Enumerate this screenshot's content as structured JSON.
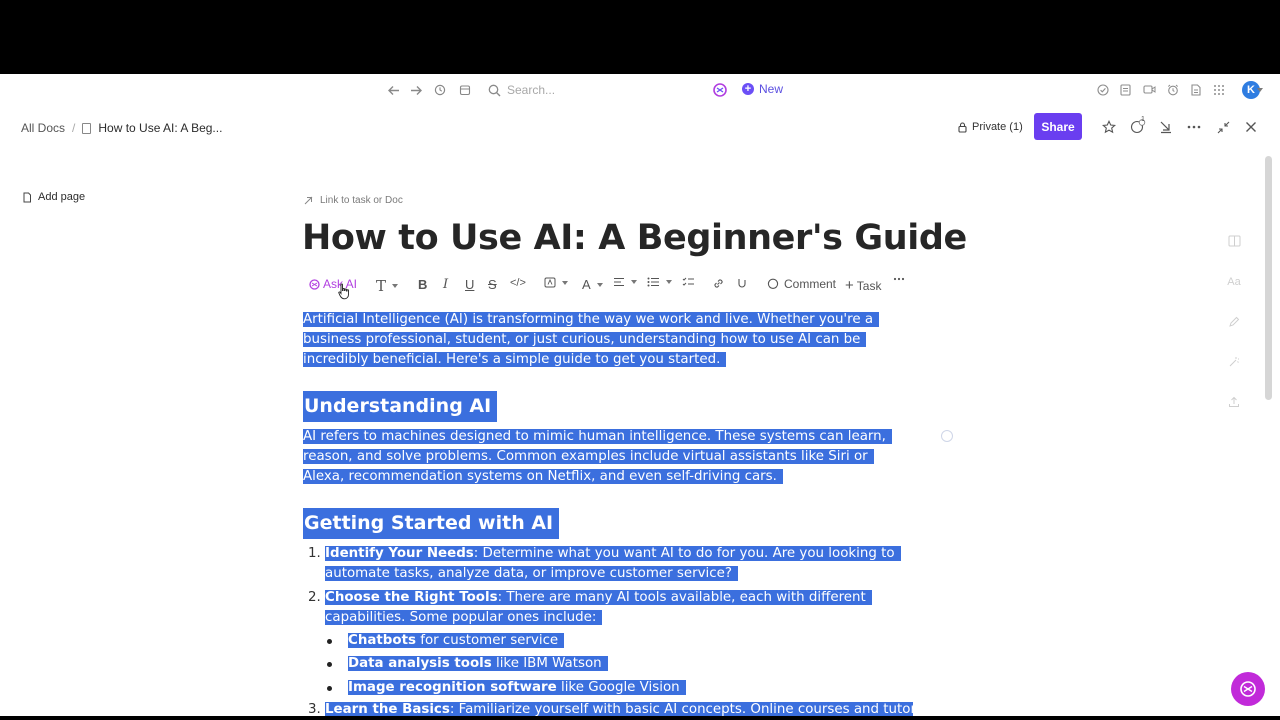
{
  "topnav": {
    "search_placeholder": "Search...",
    "new_label": "New"
  },
  "avatar": {
    "initial": "K",
    "color": "#2f7de1"
  },
  "breadcrumb": {
    "root": "All Docs",
    "separator": "/",
    "current": "How to Use AI: A Beg..."
  },
  "header": {
    "privacy": "Private (1)",
    "share_label": "Share",
    "notification_count": "1"
  },
  "sidebar": {
    "add_page_label": "Add page"
  },
  "doc": {
    "link_label": "Link to task or Doc",
    "title": "How to Use AI: A Beginner's Guide",
    "intro": "Artificial Intelligence (AI) is transforming the way we work and live. Whether you're a business professional, student, or just curious, understanding how to use AI can be incredibly beneficial. Here's a simple guide to get you started.",
    "section1_title": "Understanding AI",
    "section1_body": "AI refers to machines designed to mimic human intelligence. These systems can learn, reason, and solve problems. Common examples include virtual assistants like Siri or Alexa, recommendation systems on Netflix, and even self-driving cars.",
    "section2_title": "Getting Started with AI",
    "steps": [
      {
        "num": "1.",
        "bold": "Identify Your Needs",
        "text": ": Determine what you want AI to do for you. Are you looking to automate tasks, analyze data, or improve customer service?"
      },
      {
        "num": "2.",
        "bold": "Choose the Right Tools",
        "text": ": There are many AI tools available, each with different capabilities. Some popular ones include:"
      },
      {
        "num": "3.",
        "bold": "Learn the Basics",
        "text": ": Familiarize yourself with basic AI concepts. Online courses and tutorials can be"
      }
    ],
    "tools": [
      {
        "bold": "Chatbots",
        "text": " for customer service"
      },
      {
        "bold": "Data analysis tools",
        "text": " like IBM Watson"
      },
      {
        "bold": "Image recognition software",
        "text": " like Google Vision"
      }
    ]
  },
  "toolbar": {
    "ask_ai": "Ask AI",
    "comment": "Comment",
    "task": "Task"
  },
  "colors": {
    "selection": "#3b6fde",
    "share_button": "#6a3ef0",
    "ai_accent": "#b13fe0",
    "fab": "#c12ad9"
  }
}
